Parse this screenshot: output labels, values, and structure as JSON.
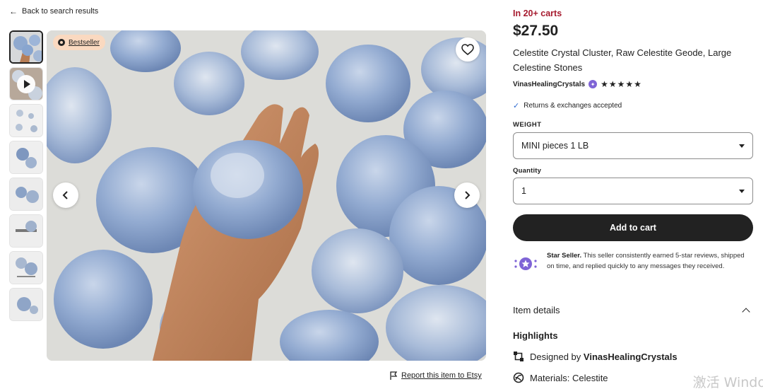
{
  "back_link": {
    "label": "Back to search results",
    "icon": "arrow-left-icon"
  },
  "gallery": {
    "thumbnails": [
      {
        "kind": "image",
        "active": true
      },
      {
        "kind": "video"
      },
      {
        "kind": "image"
      },
      {
        "kind": "image"
      },
      {
        "kind": "image"
      },
      {
        "kind": "image"
      },
      {
        "kind": "image"
      },
      {
        "kind": "image"
      }
    ],
    "badge": "Bestseller",
    "report_label": "Report this item to Etsy"
  },
  "product": {
    "in_carts": "In 20+ carts",
    "price": "$27.50",
    "title": "Celestite Crystal Cluster, Raw Celestite Geode, Large Celestine Stones",
    "seller_name": "VinasHealingCrystals",
    "rating_stars": 5,
    "stars_text": "★★★★★",
    "returns": "Returns & exchanges accepted"
  },
  "options": {
    "weight_label": "WEIGHT",
    "weight_value": "MINI pieces 1 LB",
    "quantity_label": "Quantity",
    "quantity_value": "1"
  },
  "cart": {
    "add_label": "Add to cart"
  },
  "star_seller": {
    "title": "Star Seller.",
    "text": " This seller consistently earned 5-star reviews, shipped on time, and replied quickly to any messages they received."
  },
  "details": {
    "section_label": "Item details",
    "highlights_label": "Highlights",
    "designed_by_prefix": "Designed by ",
    "designed_by_name": "VinasHealingCrystals",
    "materials": "Materials: Celestite"
  },
  "watermark": "激活 Windo",
  "colors": {
    "in_carts": "#a61a2e",
    "button_bg": "#222222",
    "badge_bg": "#fad9c0",
    "star_seller_purple": "#7f64d6",
    "check_blue": "#2f6bd0"
  }
}
